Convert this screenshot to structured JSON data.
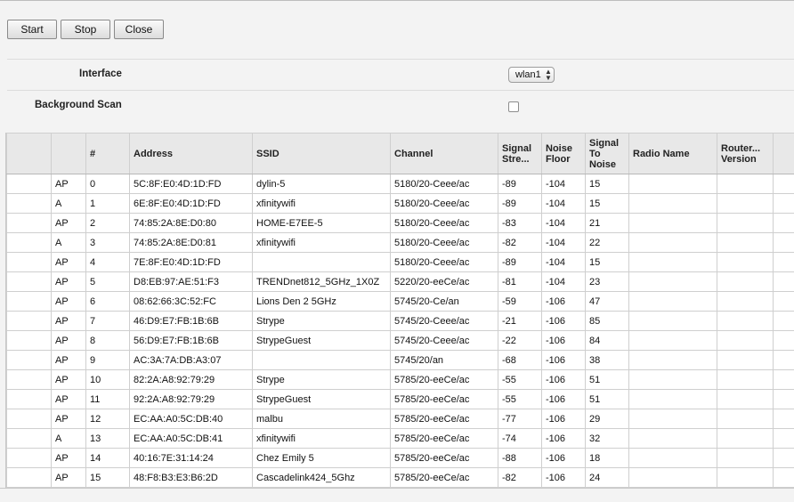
{
  "toolbar": {
    "start_label": "Start",
    "stop_label": "Stop",
    "close_label": "Close"
  },
  "settings": {
    "interface_label": "Interface",
    "interface_value": "wlan1",
    "background_scan_label": "Background Scan",
    "background_scan_checked": false
  },
  "table": {
    "columns": [
      "",
      "",
      "#",
      "Address",
      "SSID",
      "Channel",
      "Signal Stre...",
      "Noise Floor",
      "Signal To Noise",
      "Radio Name",
      "Router... Version",
      ""
    ],
    "header_display": [
      "",
      "",
      "#",
      "Address",
      "SSID",
      "Channel",
      "Signal\nStre...",
      "Noise\nFloor",
      "Signal\nTo\nNoise",
      "Radio Name",
      "Router...\nVersion",
      ""
    ],
    "rows": [
      [
        "",
        "AP",
        "0",
        "5C:8F:E0:4D:1D:FD",
        "dylin-5",
        "5180/20-Ceee/ac",
        "-89",
        "-104",
        "15",
        "",
        "",
        ""
      ],
      [
        "",
        "A",
        "1",
        "6E:8F:E0:4D:1D:FD",
        "xfinitywifi",
        "5180/20-Ceee/ac",
        "-89",
        "-104",
        "15",
        "",
        "",
        ""
      ],
      [
        "",
        "AP",
        "2",
        "74:85:2A:8E:D0:80",
        "HOME-E7EE-5",
        "5180/20-Ceee/ac",
        "-83",
        "-104",
        "21",
        "",
        "",
        ""
      ],
      [
        "",
        "A",
        "3",
        "74:85:2A:8E:D0:81",
        "xfinitywifi",
        "5180/20-Ceee/ac",
        "-82",
        "-104",
        "22",
        "",
        "",
        ""
      ],
      [
        "",
        "AP",
        "4",
        "7E:8F:E0:4D:1D:FD",
        "",
        "5180/20-Ceee/ac",
        "-89",
        "-104",
        "15",
        "",
        "",
        ""
      ],
      [
        "",
        "AP",
        "5",
        "D8:EB:97:AE:51:F3",
        "TRENDnet812_5GHz_1X0Z",
        "5220/20-eeCe/ac",
        "-81",
        "-104",
        "23",
        "",
        "",
        ""
      ],
      [
        "",
        "AP",
        "6",
        "08:62:66:3C:52:FC",
        "Lions Den 2 5GHz",
        "5745/20-Ce/an",
        "-59",
        "-106",
        "47",
        "",
        "",
        ""
      ],
      [
        "",
        "AP",
        "7",
        "46:D9:E7:FB:1B:6B",
        "Strype",
        "5745/20-Ceee/ac",
        "-21",
        "-106",
        "85",
        "",
        "",
        ""
      ],
      [
        "",
        "AP",
        "8",
        "56:D9:E7:FB:1B:6B",
        "StrypeGuest",
        "5745/20-Ceee/ac",
        "-22",
        "-106",
        "84",
        "",
        "",
        ""
      ],
      [
        "",
        "AP",
        "9",
        "AC:3A:7A:DB:A3:07",
        "",
        "5745/20/an",
        "-68",
        "-106",
        "38",
        "",
        "",
        ""
      ],
      [
        "",
        "AP",
        "10",
        "82:2A:A8:92:79:29",
        "Strype",
        "5785/20-eeCe/ac",
        "-55",
        "-106",
        "51",
        "",
        "",
        ""
      ],
      [
        "",
        "AP",
        "11",
        "92:2A:A8:92:79:29",
        "StrypeGuest",
        "5785/20-eeCe/ac",
        "-55",
        "-106",
        "51",
        "",
        "",
        ""
      ],
      [
        "",
        "AP",
        "12",
        "EC:AA:A0:5C:DB:40",
        "malbu",
        "5785/20-eeCe/ac",
        "-77",
        "-106",
        "29",
        "",
        "",
        ""
      ],
      [
        "",
        "A",
        "13",
        "EC:AA:A0:5C:DB:41",
        "xfinitywifi",
        "5785/20-eeCe/ac",
        "-74",
        "-106",
        "32",
        "",
        "",
        ""
      ],
      [
        "",
        "AP",
        "14",
        "40:16:7E:31:14:24",
        "Chez Emily 5",
        "5785/20-eeCe/ac",
        "-88",
        "-106",
        "18",
        "",
        "",
        ""
      ],
      [
        "",
        "AP",
        "15",
        "48:F8:B3:E3:B6:2D",
        "Cascadelink424_5Ghz",
        "5785/20-eeCe/ac",
        "-82",
        "-106",
        "24",
        "",
        "",
        ""
      ]
    ]
  }
}
